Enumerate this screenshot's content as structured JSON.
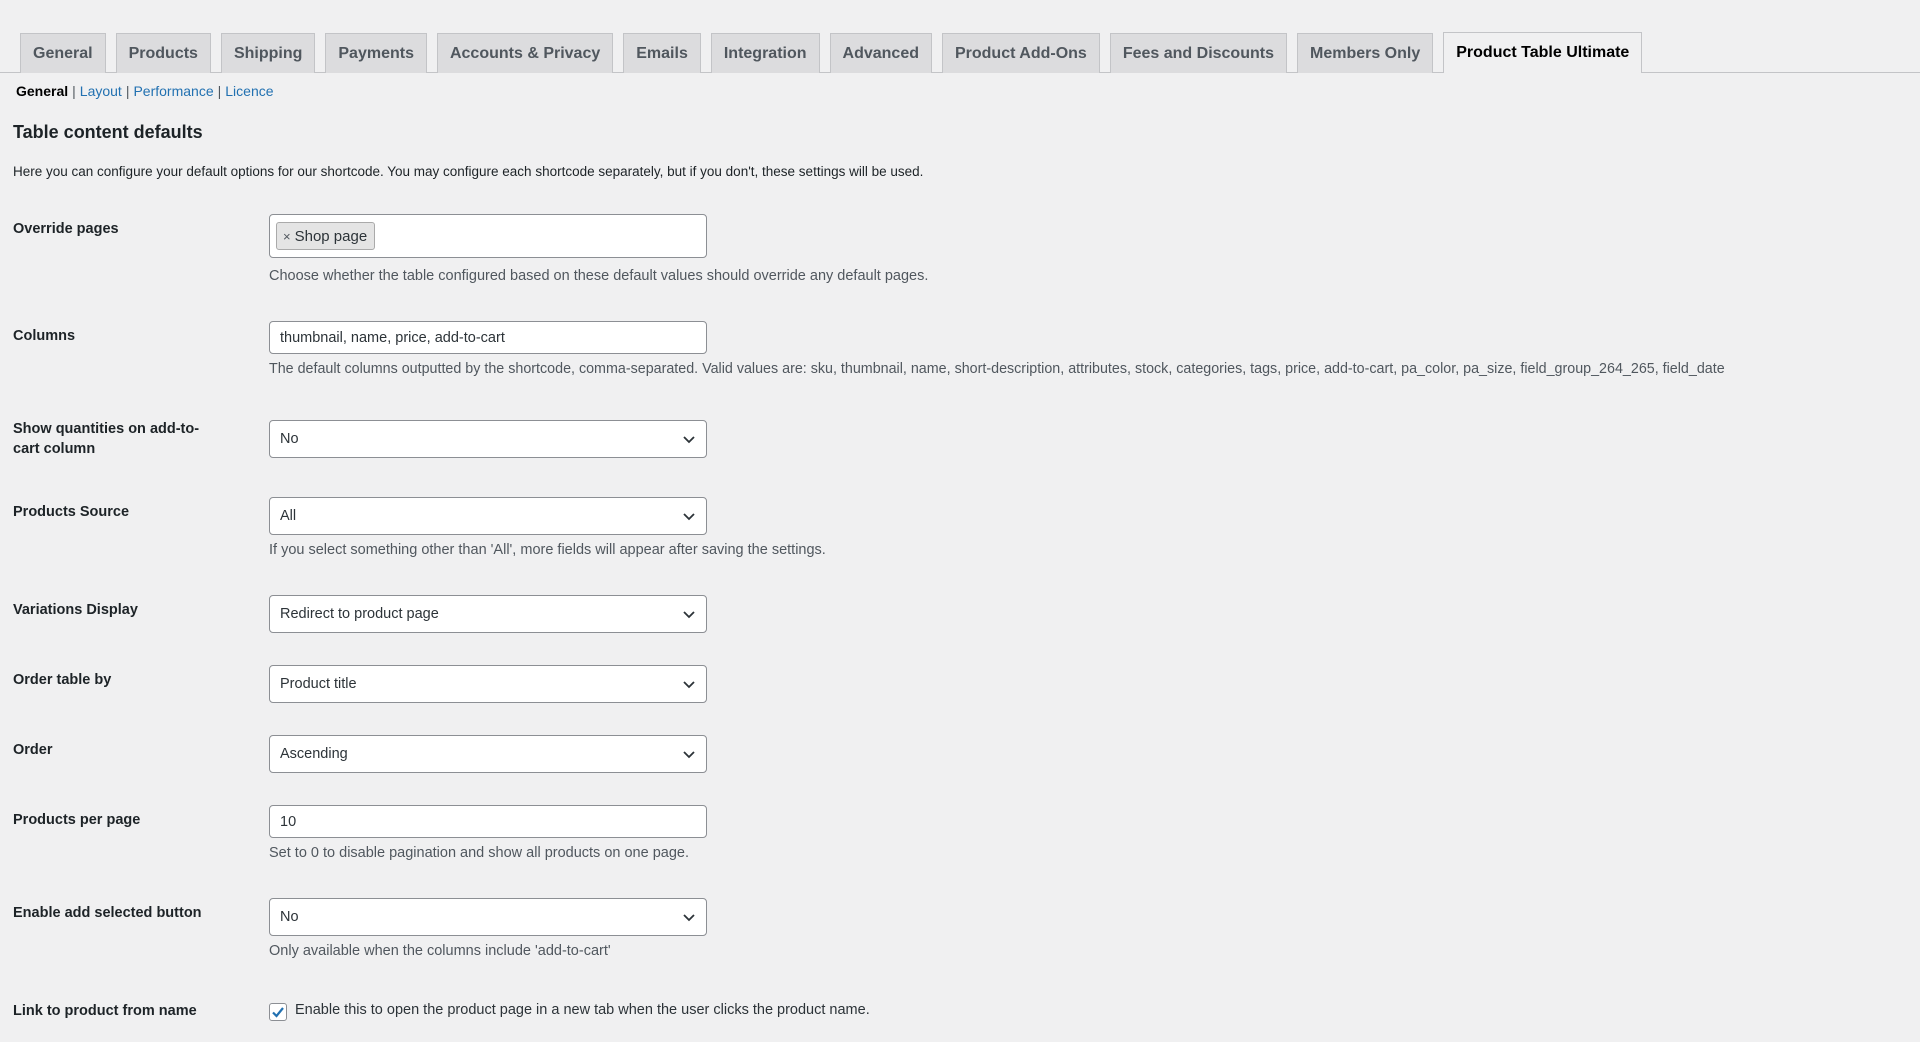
{
  "tabs": [
    {
      "label": "General"
    },
    {
      "label": "Products"
    },
    {
      "label": "Shipping"
    },
    {
      "label": "Payments"
    },
    {
      "label": "Accounts & Privacy"
    },
    {
      "label": "Emails"
    },
    {
      "label": "Integration"
    },
    {
      "label": "Advanced"
    },
    {
      "label": "Product Add-Ons"
    },
    {
      "label": "Fees and Discounts"
    },
    {
      "label": "Members Only"
    },
    {
      "label": "Product Table Ultimate"
    }
  ],
  "active_tab": "Product Table Ultimate",
  "subnav": {
    "current": "General",
    "links": [
      "Layout",
      "Performance",
      "Licence"
    ],
    "separator": "|"
  },
  "section": {
    "title": "Table content defaults",
    "intro": "Here you can configure your default options for our shortcode. You may configure each shortcode separately, but if you don't, these settings will be used."
  },
  "fields": {
    "override_pages": {
      "label": "Override pages",
      "token": "Shop page",
      "token_remove": "×",
      "description": "Choose whether the table configured based on these default values should override any default pages."
    },
    "columns": {
      "label": "Columns",
      "value": "thumbnail, name, price, add-to-cart",
      "description": "The default columns outputted by the shortcode, comma-separated. Valid values are: sku, thumbnail, name, short-description, attributes, stock, categories, tags, price, add-to-cart, pa_color, pa_size, field_group_264_265, field_date"
    },
    "show_quantities": {
      "label_line1": "Show quantities on add-to-",
      "label_line2": "cart column",
      "value": "No"
    },
    "products_source": {
      "label": "Products Source",
      "value": "All",
      "description": "If you select something other than 'All', more fields will appear after saving the settings."
    },
    "variations_display": {
      "label": "Variations Display",
      "value": "Redirect to product page"
    },
    "order_by": {
      "label": "Order table by",
      "value": "Product title"
    },
    "order": {
      "label": "Order",
      "value": "Ascending"
    },
    "per_page": {
      "label": "Products per page",
      "value": "10",
      "description": "Set to 0 to disable pagination and show all products on one page."
    },
    "add_selected": {
      "label": "Enable add selected button",
      "value": "No",
      "description": "Only available when the columns include 'add-to-cart'"
    },
    "link_to_product": {
      "label": "Link to product from name",
      "checked": true,
      "check_label": "Enable this to open the product page in a new tab when the user clicks the product name."
    }
  },
  "colors": {
    "link": "#2271b1",
    "checkbox_check": "#2271b1"
  }
}
